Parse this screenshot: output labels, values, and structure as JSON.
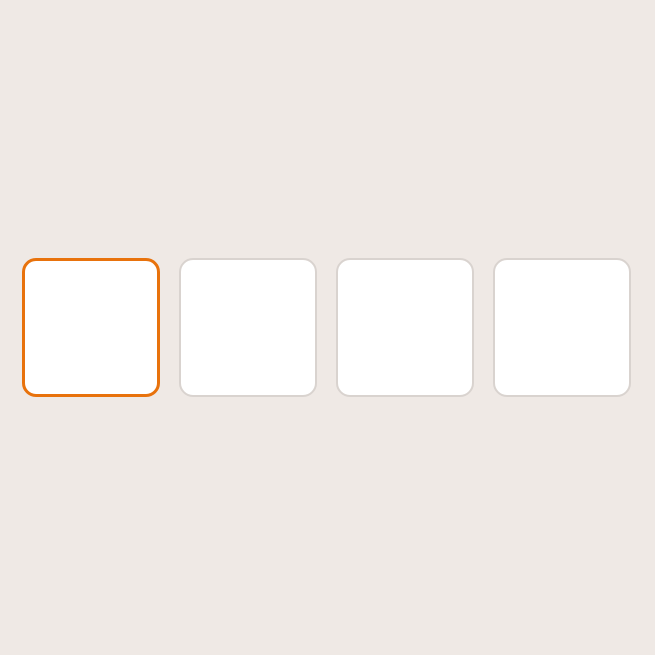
{
  "code_input": {
    "digits": [
      {
        "value": "",
        "focused": true
      },
      {
        "value": "",
        "focused": false
      },
      {
        "value": "",
        "focused": false
      },
      {
        "value": "",
        "focused": false
      }
    ]
  },
  "colors": {
    "background": "#efe9e5",
    "box_fill": "#ffffff",
    "box_border": "#d9d3cf",
    "focus_border": "#e8720c"
  }
}
